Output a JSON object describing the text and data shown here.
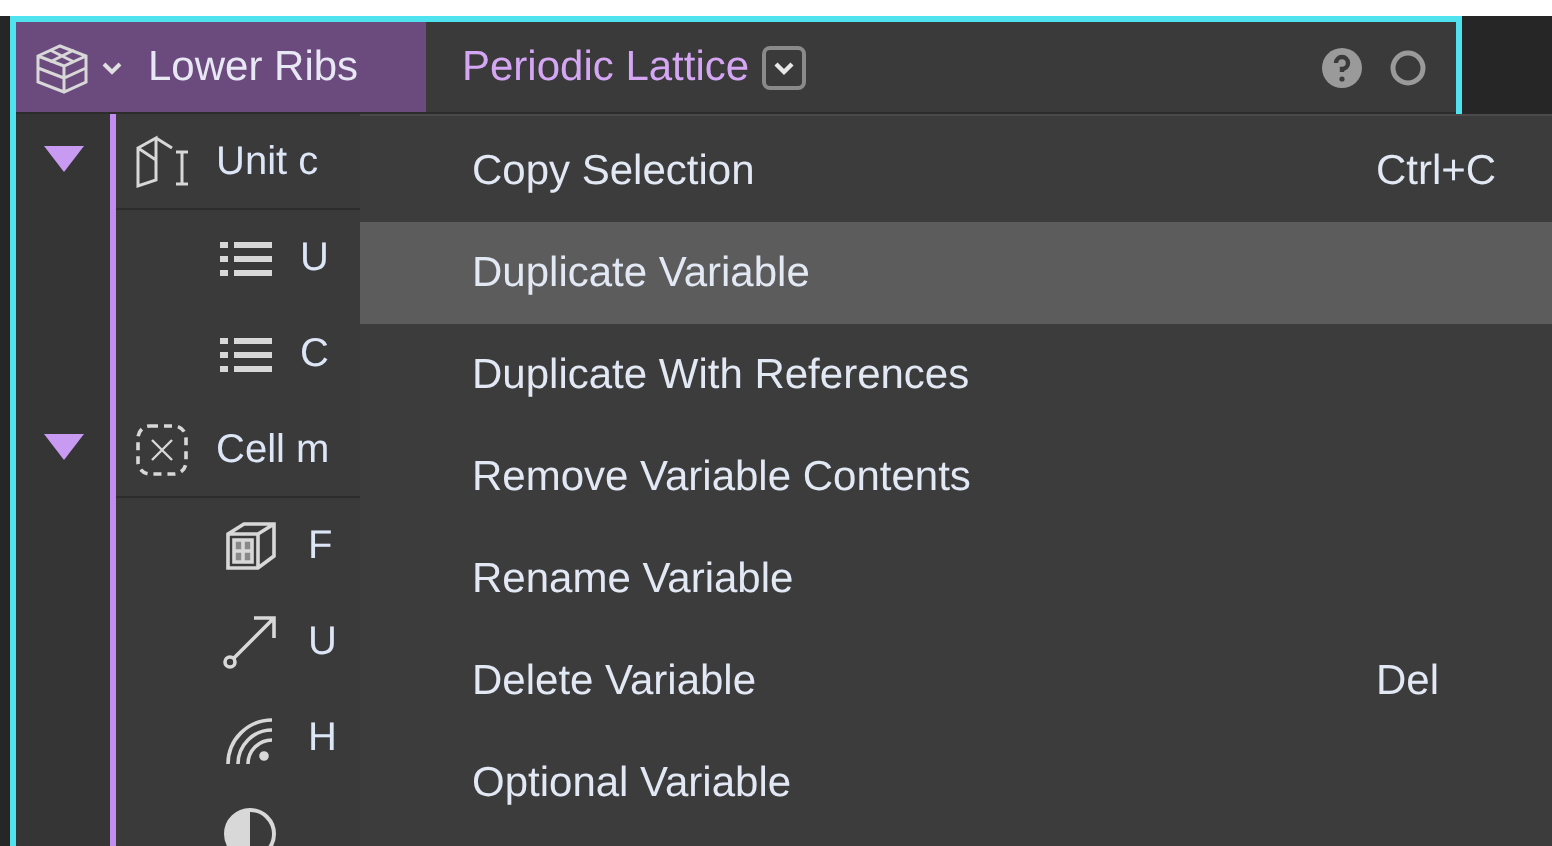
{
  "header": {
    "title": "Lower Ribs",
    "type_label": "Periodic Lattice"
  },
  "tree": [
    {
      "label": "Unit c",
      "kind": "frame",
      "expanded": true,
      "children": [
        {
          "label": "U",
          "kind": "list"
        },
        {
          "label": "C",
          "kind": "list"
        }
      ]
    },
    {
      "label": "Cell m",
      "kind": "cellmap",
      "expanded": true,
      "children": [
        {
          "label": "F",
          "kind": "cube"
        },
        {
          "label": "U",
          "kind": "arrow"
        },
        {
          "label": "H",
          "kind": "wave"
        },
        {
          "kind": "half"
        }
      ]
    }
  ],
  "menu": [
    {
      "label": "Copy Selection",
      "shortcut": "Ctrl+C",
      "selected": false
    },
    {
      "label": "Duplicate Variable",
      "selected": true
    },
    {
      "label": "Duplicate With References",
      "selected": false
    },
    {
      "label": "Remove Variable Contents",
      "selected": false
    },
    {
      "label": "Rename Variable",
      "selected": false
    },
    {
      "label": "Delete Variable",
      "shortcut": "Del",
      "selected": false
    },
    {
      "label": "Optional Variable",
      "selected": false
    }
  ]
}
